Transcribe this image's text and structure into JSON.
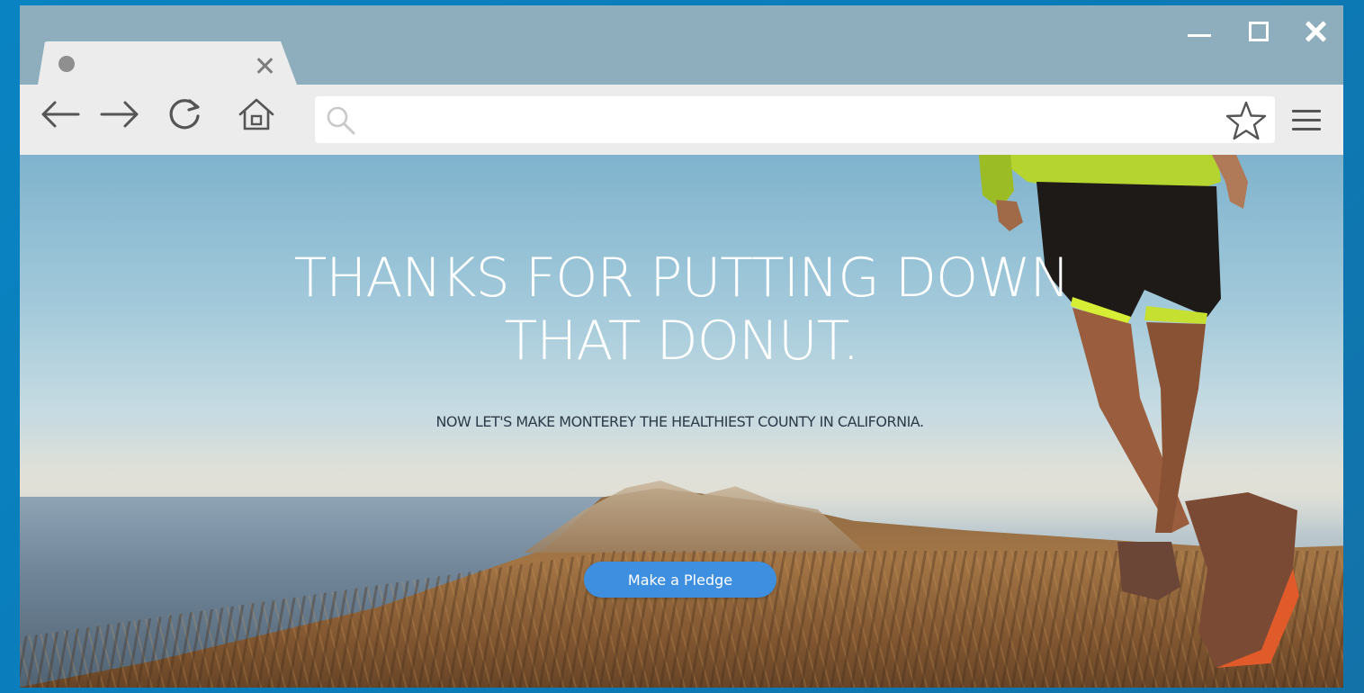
{
  "browser": {
    "tab": {
      "title": ""
    },
    "address_bar": {
      "value": "",
      "placeholder": ""
    },
    "icons": {
      "back": "arrow-left-icon",
      "forward": "arrow-right-icon",
      "reload": "reload-icon",
      "home": "home-icon",
      "search": "search-icon",
      "bookmark": "star-icon",
      "menu": "hamburger-menu-icon",
      "minimize": "minimize-icon",
      "maximize": "maximize-icon",
      "close": "close-icon"
    }
  },
  "hero": {
    "headline_line1": "THANKS FOR PUTTING DOWN",
    "headline_line2": "THAT DONUT.",
    "subheadline": "NOW LET'S MAKE MONTEREY THE HEALTHIEST COUNTY IN CALIFORNIA.",
    "cta_label": "Make a Pledge"
  },
  "colors": {
    "desktop_background": "#0a83c2",
    "titlebar": "#8eaebd",
    "toolbar": "#ececec",
    "cta_button": "#3f8fe0",
    "headline_text": "#ffffff",
    "subheadline_text": "#2d3b49"
  }
}
